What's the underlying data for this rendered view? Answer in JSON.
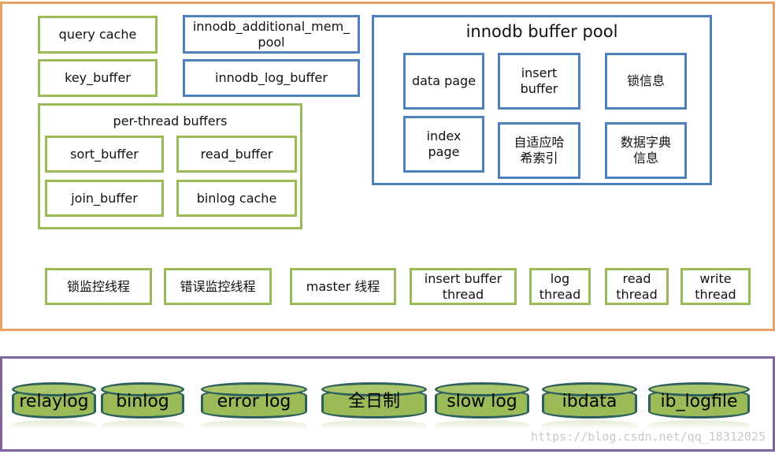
{
  "colors": {
    "server_frame": "#eba064",
    "storage_frame": "#8064a2",
    "green_box": "#9bbb59",
    "blue_box": "#4f81bd",
    "cylinder_fill": "#9bbb59"
  },
  "memory": {
    "query_cache": "query cache",
    "key_buffer": "key_buffer",
    "innodb_additional_mem_pool": "innodb_additional_mem_pool",
    "innodb_log_buffer": "innodb_log_buffer",
    "per_thread": {
      "title": "per-thread buffers",
      "items": [
        "sort_buffer",
        "read_buffer",
        "join_buffer",
        "binlog cache"
      ]
    },
    "buffer_pool": {
      "title": "innodb buffer pool",
      "items": [
        "data page",
        "insert buffer",
        "锁信息",
        "index page",
        "自适应哈希索引",
        "数据字典信息"
      ]
    }
  },
  "threads": [
    "锁监控线程",
    "错误监控线程",
    "master 线程",
    "insert buffer thread",
    "log thread",
    "read thread",
    "write thread"
  ],
  "files": [
    "relaylog",
    "binlog",
    "error log",
    "全日制",
    "slow log",
    "ibdata",
    "ib_logfile"
  ],
  "watermark": "https://blog.csdn.net/qq_18312025"
}
